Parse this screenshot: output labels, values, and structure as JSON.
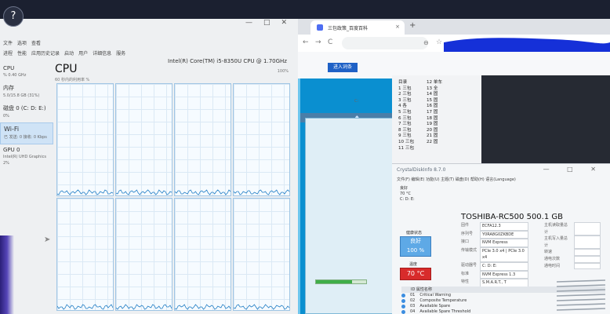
{
  "help_button": "?",
  "task_manager": {
    "title_buttons": [
      "—",
      "□",
      "✕"
    ],
    "menu": [
      "文件",
      "选项",
      "查看"
    ],
    "tabs": [
      "进程",
      "性能",
      "应用历史记录",
      "启动",
      "用户",
      "详细信息",
      "服务"
    ],
    "side_items": [
      {
        "name": "CPU",
        "detail": "% 0.40 GHz"
      },
      {
        "name": "内存",
        "detail": "5.0/15.8 GB (31%)"
      },
      {
        "name": "磁盘 0 (C: D: E:)",
        "detail": "0%"
      },
      {
        "name": "Wi-Fi",
        "detail": "已 发送: 0 接收: 0 Kbps"
      },
      {
        "name": "GPU 0",
        "detail": "Intel(R) UHD Graphics",
        "detail2": "2%"
      }
    ],
    "cpu_heading": "CPU",
    "cpu_model": "Intel(R) Core(TM) i5-8350U CPU @ 1.70GHz",
    "cpu_sub": "60 秒内的利用率 %",
    "cpu_max": "100%"
  },
  "browser": {
    "tab_title": "三包政策_百度百科",
    "tab_close": "×",
    "new_tab": "+",
    "nav_back": "←",
    "nav_forward": "→",
    "nav_reload": "C",
    "zoom": "⊖",
    "star": "☆",
    "enter_button": "进入词条"
  },
  "baidu_list": {
    "col_a": [
      "目录",
      "1 三包",
      "2 三包",
      "3 三包",
      "4 各",
      "5 三包",
      "6 三包",
      "7 三包",
      "8 三包",
      "9 三包",
      "10 三包",
      "11 三包"
    ],
    "col_b": [
      "12 单车",
      "13 全",
      "14 固",
      "15 固",
      "16 固",
      "17 固",
      "18 固",
      "19 固",
      "20 固",
      "21 固",
      "22 固"
    ]
  },
  "dialog": {
    "small_text": "C:",
    "bar_label": "",
    "bar_percent": "",
    "bar_fill": 0.72
  },
  "crystal": {
    "title": "CrystalDiskInfo 8.7.0",
    "win_buttons": "— □ ✕",
    "menu": "文件(F)  编辑(E)  功能(U)  主题(T)  磁盘(D)  帮助(H)  语言(Language)",
    "mini_lines": [
      "良好",
      "70 °C",
      "C: D: E:"
    ],
    "disk_title": "TOSHIBA-RC500 500.1 GB",
    "health_label": "健康状态",
    "health_word": "良好",
    "health_pct": "100 %",
    "temp_label": "温度",
    "temp_value": "70 °C",
    "info_left": [
      {
        "label": "固件",
        "value": "ECFA12.3"
      },
      {
        "label": "序列号",
        "value": "Y0RA8G0ZKBDE"
      },
      {
        "label": "接口",
        "value": "NVM Express"
      },
      {
        "label": "传输模式",
        "value": "PCIe 3.0 x4 | PCIe 3.0 x4"
      },
      {
        "label": "驱动器号",
        "value": "C: D: E:"
      },
      {
        "label": "标准",
        "value": "NVM Express 1.3"
      },
      {
        "label": "特性",
        "value": "S.M.A.R.T., T"
      }
    ],
    "info_right": [
      {
        "label": "主机读取量总计",
        "value": ""
      },
      {
        "label": "主机写入量总计",
        "value": ""
      },
      {
        "label": "转速",
        "value": ""
      },
      {
        "label": "通电次数",
        "value": ""
      },
      {
        "label": "通电时间",
        "value": ""
      }
    ],
    "attr_header": "ID   属性名称",
    "attributes": [
      {
        "id": "01",
        "name": "Critical Warning"
      },
      {
        "id": "02",
        "name": "Composite Temperature"
      },
      {
        "id": "03",
        "name": "Available Spare"
      },
      {
        "id": "04",
        "name": "Available Spare Threshold"
      }
    ]
  }
}
